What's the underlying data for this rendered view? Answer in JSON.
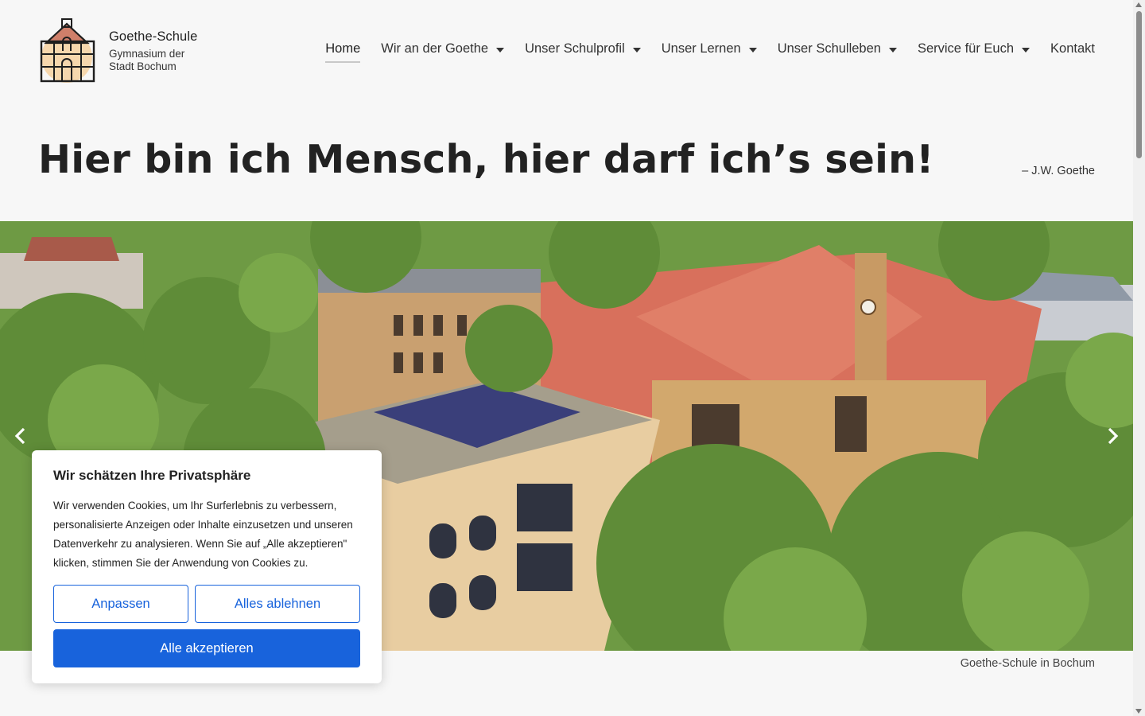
{
  "brand": {
    "name": "Goethe-Schule",
    "subtitle": "Gymnasium der Stadt Bochum",
    "logo_icon": "school-building-logo"
  },
  "nav": {
    "items": [
      {
        "label": "Home",
        "active": true,
        "has_dropdown": false
      },
      {
        "label": "Wir an der Goethe",
        "active": false,
        "has_dropdown": true
      },
      {
        "label": "Unser Schulprofil",
        "active": false,
        "has_dropdown": true
      },
      {
        "label": "Unser Lernen",
        "active": false,
        "has_dropdown": true
      },
      {
        "label": "Unser Schulleben",
        "active": false,
        "has_dropdown": true
      },
      {
        "label": "Service für Euch",
        "active": false,
        "has_dropdown": true
      },
      {
        "label": "Kontakt",
        "active": false,
        "has_dropdown": false
      }
    ]
  },
  "hero": {
    "headline": "Hier bin ich Mensch, hier darf ich’s sein!",
    "quote_author": "– J.W. Goethe",
    "caption": "Goethe-Schule in Bochum",
    "image_icon": "school-aerial-photo",
    "prev_icon": "chevron-left-icon",
    "next_icon": "chevron-right-icon"
  },
  "cookie": {
    "title": "Wir schätzen Ihre Privatsphäre",
    "text": "Wir verwenden Cookies, um Ihr Surferlebnis zu verbessern, personalisierte Anzeigen oder Inhalte einzusetzen und unseren Datenverkehr zu analysieren. Wenn Sie auf „Alle akzeptieren\" klicken, stimmen Sie der Anwendung von Cookies zu.",
    "customize_label": "Anpassen",
    "reject_label": "Alles ablehnen",
    "accept_label": "Alle akzeptieren"
  },
  "colors": {
    "accent": "#1863dc",
    "background": "#f7f7f7",
    "text": "#222222"
  }
}
